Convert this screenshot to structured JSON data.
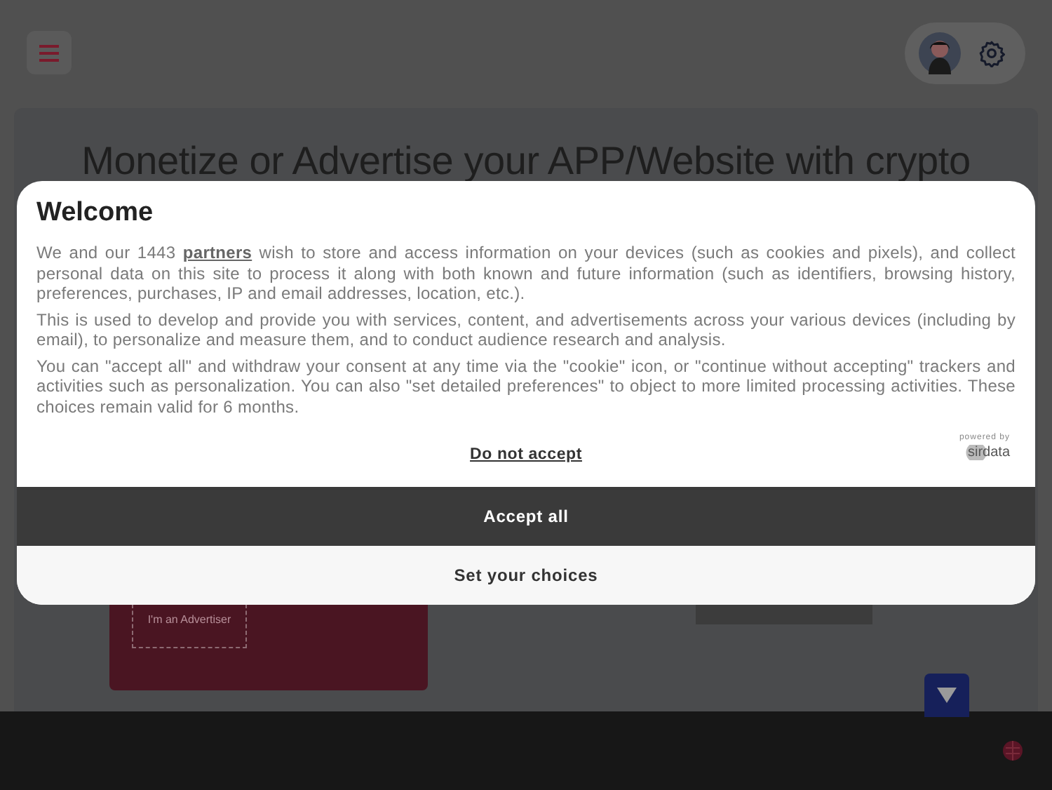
{
  "page": {
    "heading": "Monetize or Advertise your APP/Website with crypto",
    "advertiser_button": "I'm an Advertiser"
  },
  "consent": {
    "title": "Welcome",
    "intro": {
      "before": "We and our 1443",
      "link": "partners",
      "after": "wish to store and access information on your devices (such as cookies and pixels), and collect personal data on this site to process it along with both known and future information (such as identifiers, browsing history, preferences, purchases, IP and email addresses, location, etc.)."
    },
    "paragraphs": [
      "This is used to develop and provide you with services, content, and advertisements across your various devices (including by email), to personalize and measure them, and to conduct audience research and analysis.",
      "You can \"accept all\" and withdraw your consent at any time via the \"cookie\" icon, or \"continue without accepting\" trackers and activities such as personalization. You can also \"set detailed preferences\" to object to more limited processing activities. These choices remain valid for 6 months."
    ],
    "reject": "Do not accept",
    "powered_by": "powered by",
    "brand": "sirdata",
    "buttons": [
      {
        "label": "Accept all",
        "kind": "primary"
      },
      {
        "label": "Set your choices",
        "kind": "secondary"
      }
    ]
  }
}
